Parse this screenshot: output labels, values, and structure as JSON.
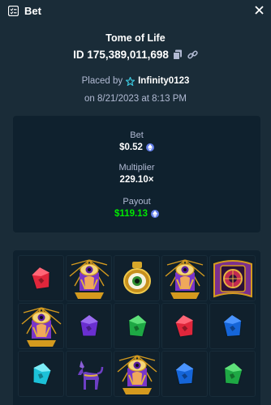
{
  "header": {
    "title": "Bet"
  },
  "bet": {
    "game": "Tome of Life",
    "id": "ID 175,389,011,698",
    "placed_by_label": "Placed by",
    "user": "Infinity0123",
    "date": "on 8/21/2023 at 8:13 PM"
  },
  "stats": {
    "bet_label": "Bet",
    "bet_value": "$0.52",
    "multiplier_label": "Multiplier",
    "multiplier_value": "229.10×",
    "payout_label": "Payout",
    "payout_value": "$119.13"
  },
  "colors": {
    "background": "#1a2c38",
    "card": "#0f212e",
    "payout_green": "#00e701",
    "currency_blue": "#627eea"
  },
  "reels": [
    [
      "red-gem",
      "eye-pharaoh",
      "eye-ring",
      "eye-pharaoh",
      "tome-book"
    ],
    [
      "eye-pharaoh",
      "purple-gem",
      "green-gem",
      "red-gem",
      "blue-gem"
    ],
    [
      "cyan-gem",
      "anubis-jackal",
      "eye-pharaoh",
      "blue-gem",
      "green-gem"
    ]
  ],
  "icons": {
    "header": "bet-list-icon",
    "close": "close-icon",
    "copy": "copy-icon",
    "link": "link-icon",
    "user": "vip-star-icon",
    "currency": "ethereum-coin-icon"
  }
}
